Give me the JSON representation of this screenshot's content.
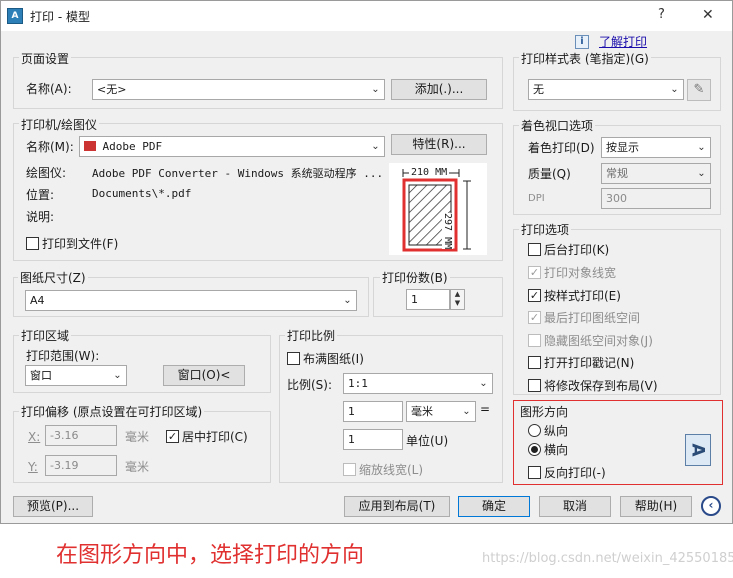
{
  "window": {
    "title": "打印 - 模型",
    "help_btn": "?",
    "close_btn": "✕",
    "learn_link": "了解打印"
  },
  "page_setup": {
    "title": "页面设置",
    "name_label": "名称(A):",
    "name_value": "<无>",
    "add_button": "添加(.)..."
  },
  "printer": {
    "title": "打印机/绘图仪",
    "name_label": "名称(M):",
    "name_value": "Adobe PDF",
    "properties_button": "特性(R)...",
    "plotter_label": "绘图仪:",
    "plotter_value": "Adobe PDF Converter - Windows 系统驱动程序 ...",
    "location_label": "位置:",
    "location_value": "Documents\\*.pdf",
    "description_label": "说明:",
    "print_to_file": "打印到文件(F)",
    "preview_width": "210 MM",
    "preview_height": "297 MM"
  },
  "paper_size": {
    "title": "图纸尺寸(Z)",
    "value": "A4"
  },
  "copies": {
    "title": "打印份数(B)",
    "value": "1"
  },
  "plot_area": {
    "title": "打印区域",
    "range_label": "打印范围(W):",
    "range_value": "窗口",
    "window_button": "窗口(O)<"
  },
  "plot_offset": {
    "title": "打印偏移 (原点设置在可打印区域)",
    "x_label": "X:",
    "x_value": "-3.16",
    "x_unit": "毫米",
    "y_label": "Y:",
    "y_value": "-3.19",
    "y_unit": "毫米",
    "center_label": "居中打印(C)"
  },
  "plot_scale": {
    "title": "打印比例",
    "fit_label": "布满图纸(I)",
    "scale_label": "比例(S):",
    "scale_value": "1:1",
    "value1": "1",
    "unit1": "毫米",
    "equals": "=",
    "value2": "1",
    "unit2_label": "单位(U)",
    "lineweights_label": "缩放线宽(L)"
  },
  "style_table": {
    "title": "打印样式表 (笔指定)(G)",
    "value": "无"
  },
  "shaded": {
    "title": "着色视口选项",
    "shade_label": "着色打印(D)",
    "shade_value": "按显示",
    "quality_label": "质量(Q)",
    "quality_value": "常规",
    "dpi_label": "DPI",
    "dpi_value": "300"
  },
  "options": {
    "title": "打印选项",
    "items": [
      {
        "label": "后台打印(K)",
        "checked": "",
        "disabled": false
      },
      {
        "label": "打印对象线宽",
        "checked": "✓",
        "disabled": true
      },
      {
        "label": "按样式打印(E)",
        "checked": "✓",
        "disabled": false
      },
      {
        "label": "最后打印图纸空间",
        "checked": "✓",
        "disabled": true
      },
      {
        "label": "隐藏图纸空间对象(J)",
        "checked": "",
        "disabled": true
      },
      {
        "label": "打开打印戳记(N)",
        "checked": "",
        "disabled": false
      },
      {
        "label": "将修改保存到布局(V)",
        "checked": "",
        "disabled": false
      }
    ]
  },
  "orientation": {
    "title": "图形方向",
    "portrait": "纵向",
    "landscape": "横向",
    "upside_down": "反向打印(-)",
    "icon_letter": "A",
    "highlight_color": "#e03030"
  },
  "footer": {
    "preview_button": "预览(P)...",
    "apply_button": "应用到布局(T)",
    "ok_button": "确定",
    "cancel_button": "取消",
    "help_button": "帮助(H)"
  },
  "annotation": {
    "text": "在图形方向中，选择打印的方向",
    "watermark": "https://blog.csdn.net/weixin_42550185",
    "color": "#e03030"
  }
}
